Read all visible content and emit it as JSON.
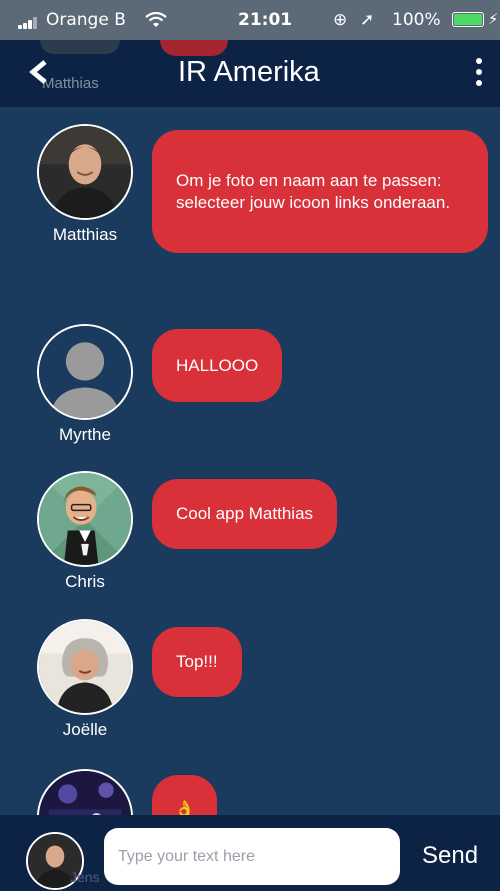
{
  "status_bar": {
    "carrier": "Orange B",
    "time": "21:01",
    "battery": "100%"
  },
  "header": {
    "title": "IR Amerika",
    "ghost_name": "Matthias"
  },
  "messages": [
    {
      "name": "Matthias",
      "text": "Om je foto en naam aan te passen: selecteer jouw icoon links onderaan.",
      "avatar": "photo-man"
    },
    {
      "name": "Myrthe",
      "text": "HALLOOO",
      "avatar": "default-person"
    },
    {
      "name": "Chris",
      "text": "Cool app Matthias",
      "avatar": "cartoon-avatar"
    },
    {
      "name": "Joëlle",
      "text": "Top!!!",
      "avatar": "photo-woman"
    },
    {
      "name": "",
      "text": "👌",
      "avatar": "photo-stage"
    }
  ],
  "composer": {
    "placeholder": "Type your text here",
    "send_label": "Send",
    "user_name": "Jens"
  },
  "colors": {
    "background": "#1a3a5e",
    "header": "#0d2346",
    "bubble": "#d8313a"
  }
}
